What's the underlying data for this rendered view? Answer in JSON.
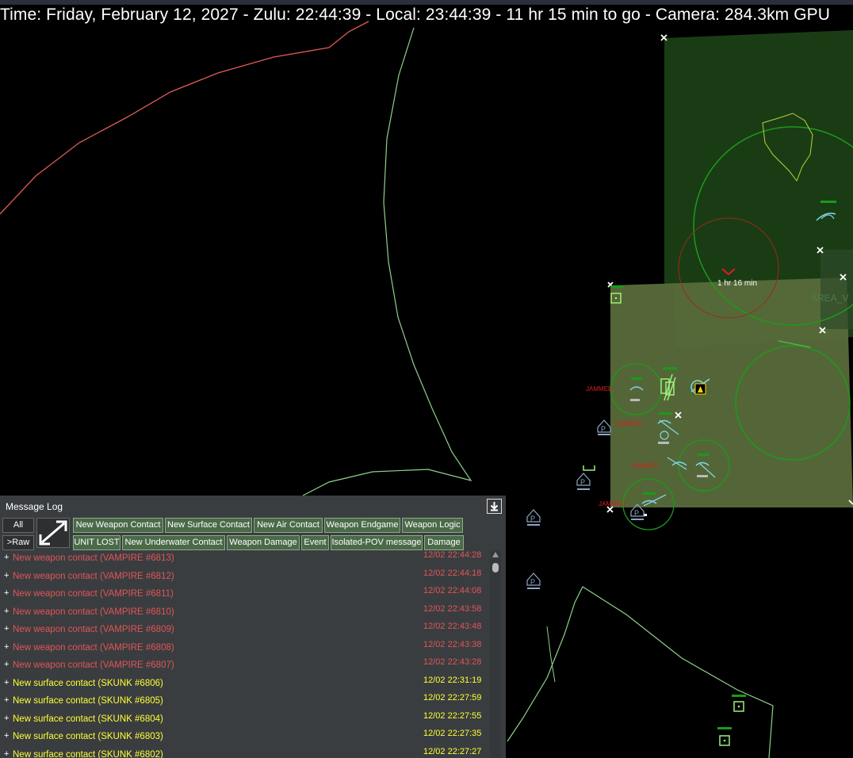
{
  "status_bar": {
    "text": "Time: Friday, February 12, 2027 - Zulu: 22:44:39 - Local: 23:44:39 - 11 hr 15 min to go - Camera: 284.3km GPU"
  },
  "map": {
    "eta_label": "1 hr 16 min",
    "area_label": "AREA_V",
    "jammed_label": "JAMMED",
    "colors": {
      "background": "#000000",
      "coastline": "#8fd18a",
      "route": "#e05a5a",
      "zone_dark": "#1f4a1a",
      "zone_light": "#5a6e3a",
      "ring": "#1faa1f",
      "threat_ring": "#b02a1a"
    }
  },
  "message_log": {
    "title": "Message Log",
    "collapse_icon": "download-arrow-icon",
    "expand_icon": "expand-arrows-icon",
    "filters_row1": [
      "All",
      "New Weapon Contact",
      "New Surface Contact",
      "New Air Contact",
      "Weapon Endgame",
      "Weapon Logic"
    ],
    "filters_row2": [
      ">Raw",
      "UNIT LOST",
      "New Underwater Contact",
      "Weapon Damage",
      "Event",
      "Isolated-POV message",
      "Damage"
    ],
    "messages": [
      {
        "text": "New weapon contact (VAMPIRE #6813)",
        "time": "12/02 22:44:28",
        "kind": "weapon"
      },
      {
        "text": "New weapon contact (VAMPIRE #6812)",
        "time": "12/02 22:44:18",
        "kind": "weapon"
      },
      {
        "text": "New weapon contact (VAMPIRE #6811)",
        "time": "12/02 22:44:08",
        "kind": "weapon"
      },
      {
        "text": "New weapon contact (VAMPIRE #6810)",
        "time": "12/02 22:43:58",
        "kind": "weapon"
      },
      {
        "text": "New weapon contact (VAMPIRE #6809)",
        "time": "12/02 22:43:48",
        "kind": "weapon"
      },
      {
        "text": "New weapon contact (VAMPIRE #6808)",
        "time": "12/02 22:43:38",
        "kind": "weapon"
      },
      {
        "text": "New weapon contact (VAMPIRE #6807)",
        "time": "12/02 22:43:28",
        "kind": "weapon"
      },
      {
        "text": "New surface contact (SKUNK #6806)",
        "time": "12/02 22:31:19",
        "kind": "surface"
      },
      {
        "text": "New surface contact (SKUNK #6805)",
        "time": "12/02 22:27:59",
        "kind": "surface"
      },
      {
        "text": "New surface contact (SKUNK #6804)",
        "time": "12/02 22:27:55",
        "kind": "surface"
      },
      {
        "text": "New surface contact (SKUNK #6803)",
        "time": "12/02 22:27:35",
        "kind": "surface"
      },
      {
        "text": "New surface contact (SKUNK #6802)",
        "time": "12/02 22:27:27",
        "kind": "surface"
      }
    ]
  }
}
